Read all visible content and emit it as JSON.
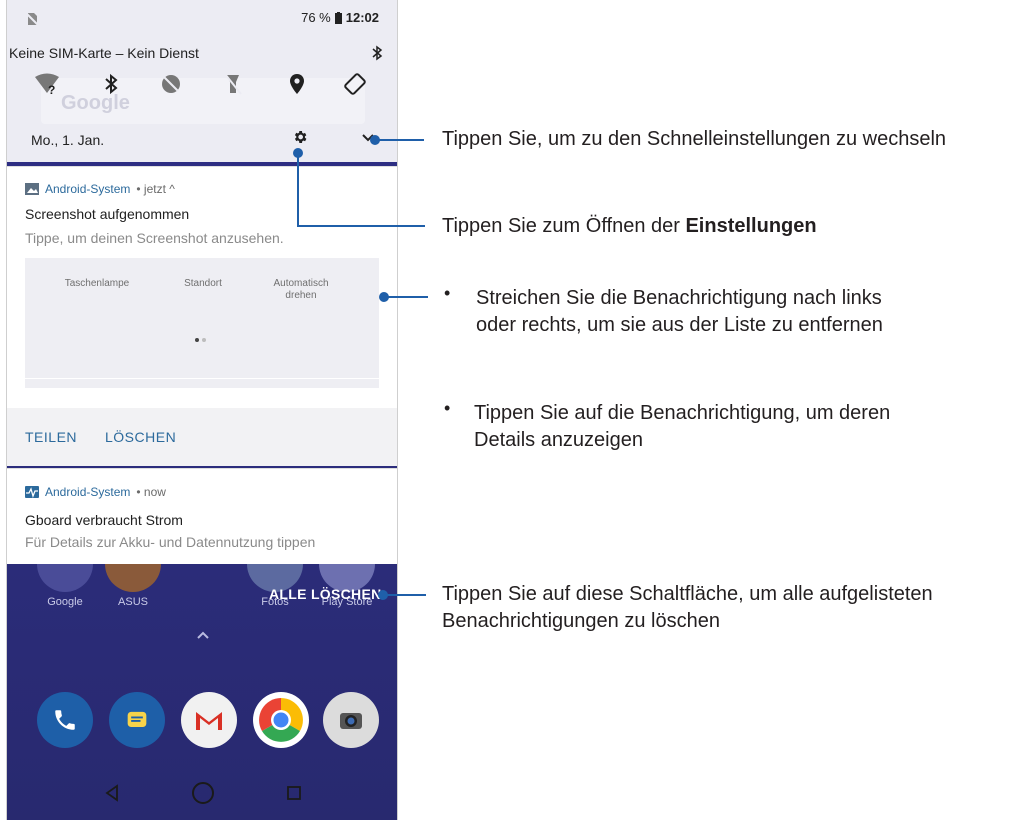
{
  "status_bar": {
    "battery": "76 %",
    "time": "12:02"
  },
  "shade": {
    "sim_status": "Keine SIM-Karte – Kein Dienst",
    "ghost_search": "Google",
    "date": "Mo., 1. Jan.",
    "quick_settings": [
      "wifi-unknown-icon",
      "bluetooth-icon",
      "data-saver-icon",
      "flashlight-off-icon",
      "location-icon",
      "auto-rotate-icon"
    ]
  },
  "notification1": {
    "app": "Android-System",
    "time": "• jetzt ^",
    "title": "Screenshot aufgenommen",
    "subtitle": "Tippe, um deinen Screenshot anzusehen.",
    "preview_tiles": [
      "Taschenlampe",
      "Standort",
      "Automatisch drehen"
    ],
    "actions": [
      "TEILEN",
      "LÖSCHEN"
    ]
  },
  "notification2": {
    "app": "Android-System",
    "time": "• now",
    "title": "Gboard verbraucht Strom",
    "subtitle": "Für Details zur Akku- und Datennutzung tippen"
  },
  "clear_all_label": "ALLE LÖSCHEN",
  "home": {
    "labels": [
      "Google",
      "ASUS",
      "Fotos",
      "Play Store"
    ]
  },
  "callouts": {
    "quick_settings": "Tippen Sie, um zu den Schnelleinstellungen zu wechseln",
    "settings_prefix": "Tippen Sie zum Öffnen der ",
    "settings_bold": "Einstellungen",
    "swipe": "Streichen Sie die Benachrichtigung nach links oder rechts, um sie aus der Liste zu entfernen",
    "tap": "Tippen Sie auf die Benachrichtigung, um deren Details anzuzeigen",
    "clear_all": "Tippen Sie auf diese Schaltfläche, um alle aufgelisteten Benachrichtigungen zu löschen"
  },
  "colors": {
    "accent": "#1f5fa9",
    "link": "#2c6a9c",
    "home_bg": "#2c2e7e",
    "shade_bg": "#ececf3"
  }
}
